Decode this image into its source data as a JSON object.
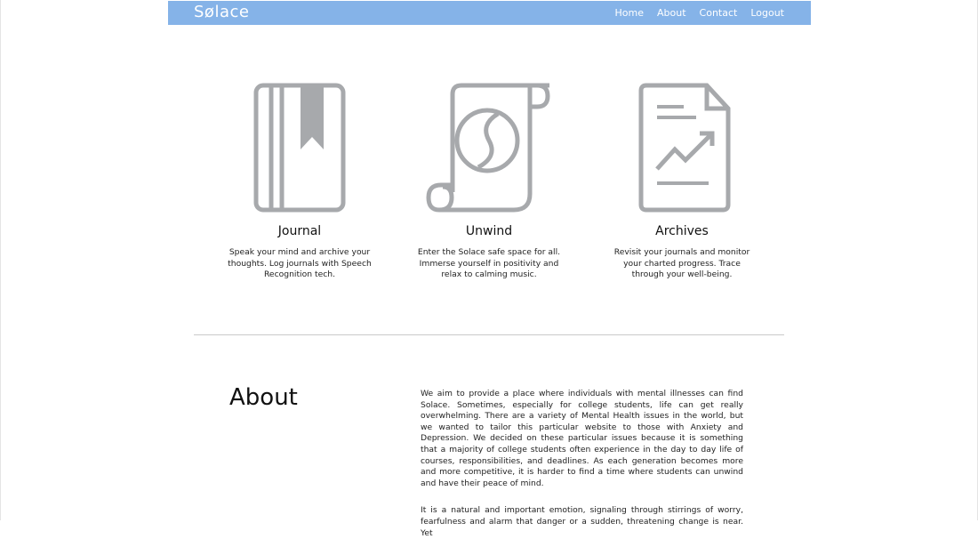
{
  "nav": {
    "brand": "Sølace",
    "links": [
      "Home",
      "About",
      "Contact",
      "Logout"
    ]
  },
  "features": [
    {
      "icon": "journal-book-icon",
      "title": "Journal",
      "description": "Speak your mind and archive your thoughts. Log journals with Speech Recognition tech."
    },
    {
      "icon": "scroll-icon",
      "title": "Unwind",
      "description": "Enter the Solace safe space for all. Immerse yourself in positivity and relax to calming music."
    },
    {
      "icon": "document-chart-icon",
      "title": "Archives",
      "description": "Revisit your journals and monitor your charted progress. Trace through your well-being."
    }
  ],
  "about": {
    "heading": "About",
    "paragraphs": [
      "We aim to provide a place where individuals with mental illnesses can find Solace. Sometimes, especially for college students, life can get really overwhelming. There are a variety of Mental Health issues in the world, but we wanted to tailor this particular website to those with Anxiety and Depression. We decided on these particular issues because it is something that a majority of college students often experience in the day to day life of courses, responsibilities, and deadlines. As each generation becomes more and more competitive, it is harder to find a time where students can unwind and have their peace of mind.",
      "It is a natural and important emotion, signaling through stirrings of worry, fearfulness and alarm that danger or a sudden, threatening change is near. Yet"
    ]
  },
  "colors": {
    "nav_background": "#85b3e8",
    "icon_gray": "#a7a9ac",
    "text": "#111111"
  }
}
